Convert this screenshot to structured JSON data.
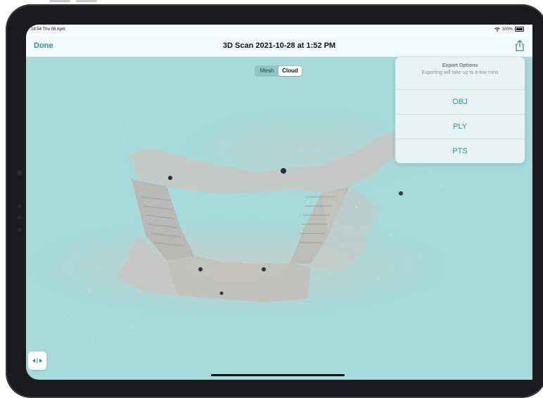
{
  "status": {
    "time": "19:54 Thu 08 April",
    "battery": "100%"
  },
  "nav": {
    "done_label": "Done",
    "title": "3D Scan 2021-10-28 at 1:52 PM"
  },
  "segmented": {
    "options": [
      "Mesh",
      "Cloud"
    ],
    "selected": "Cloud"
  },
  "export_popover": {
    "title": "Export Options",
    "subtitle": "Exporting will take up to a few mins",
    "options": [
      "OBJ",
      "PLY",
      "PTS"
    ]
  },
  "icons": {
    "share": "share-icon",
    "wifi": "wifi-icon",
    "battery": "battery-icon",
    "corner": "compare-arrows-icon"
  },
  "colors": {
    "accent": "#2f8f98",
    "background": "#a6dadb"
  }
}
